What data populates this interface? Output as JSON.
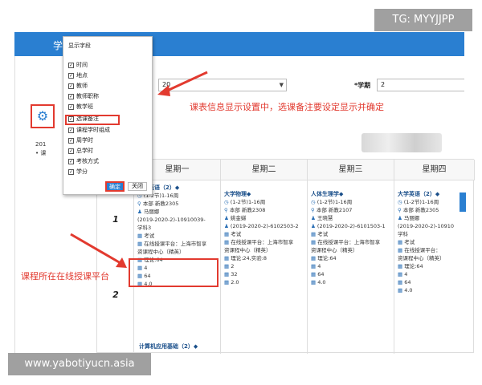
{
  "watermark": {
    "tg": "TG: MYYJJPP",
    "site": "www.yabotiyucn.asia"
  },
  "topbar": {
    "text": "学"
  },
  "filters": {
    "select_value": "20",
    "semester_label": "*学期",
    "semester_value": "2"
  },
  "left": {
    "info1": "201",
    "info2": "• 课"
  },
  "popup": {
    "title": "显示字段",
    "items": [
      "时间",
      "地点",
      "教师",
      "教师职称",
      "教学班",
      "选课备注",
      "课程学时组成",
      "周学时",
      "总学时",
      "考核方式",
      "学分"
    ],
    "ok": "确定",
    "close": "关闭"
  },
  "annotations": {
    "top": "课表信息显示设置中，选课备注要设定显示并确定",
    "left": "课程所在在线授课平台"
  },
  "timetable": {
    "headers": [
      "星期一",
      "星期二",
      "星期三",
      "星期四"
    ],
    "rows": [
      "1",
      "2"
    ],
    "mon": {
      "title": "大学英语（2）◆",
      "lines": [
        "(1-2节)1-16周",
        "本部 新教2305",
        "马丽娜",
        "(2019-2020-2)-10910039-",
        "学科3",
        "考试",
        "在线授课平台：上海市智享",
        "资课程中心（精英）",
        "理论:64",
        "4",
        "64",
        "4.0"
      ]
    },
    "tue": {
      "title": "大学物理◆",
      "lines": [
        "(1-2节)1-16周",
        "本部 新教2308",
        "姚金娣",
        "(2019-2020-2)-6102503-2",
        "考试",
        "在线授课平台：上海市智享",
        "资课程中心（精英）",
        "理论:24,实验:8",
        "2",
        "32",
        "2.0"
      ]
    },
    "wed": {
      "title": "人体生理学◆",
      "lines": [
        "(1-2节)1-16周",
        "本部 新教2107",
        "王晓慧",
        "(2019-2020-2)-6101503-1",
        "考试",
        "在线授课平台：上海市智享",
        "资课程中心（精英）",
        "理论:64",
        "4",
        "64",
        "4.0"
      ]
    },
    "thu": {
      "title": "大学英语（2）◆",
      "lines": [
        "(1-2节)1-16周",
        "本部 新教2305",
        "马丽娜",
        "(2019-2020-2)-10910",
        "学科",
        "考试",
        "在线授课平台：",
        "资课程中心（精英）",
        "理论:64",
        "4",
        "64",
        "4.0"
      ]
    },
    "bottom_title": "计算机应用基础（2）◆"
  }
}
